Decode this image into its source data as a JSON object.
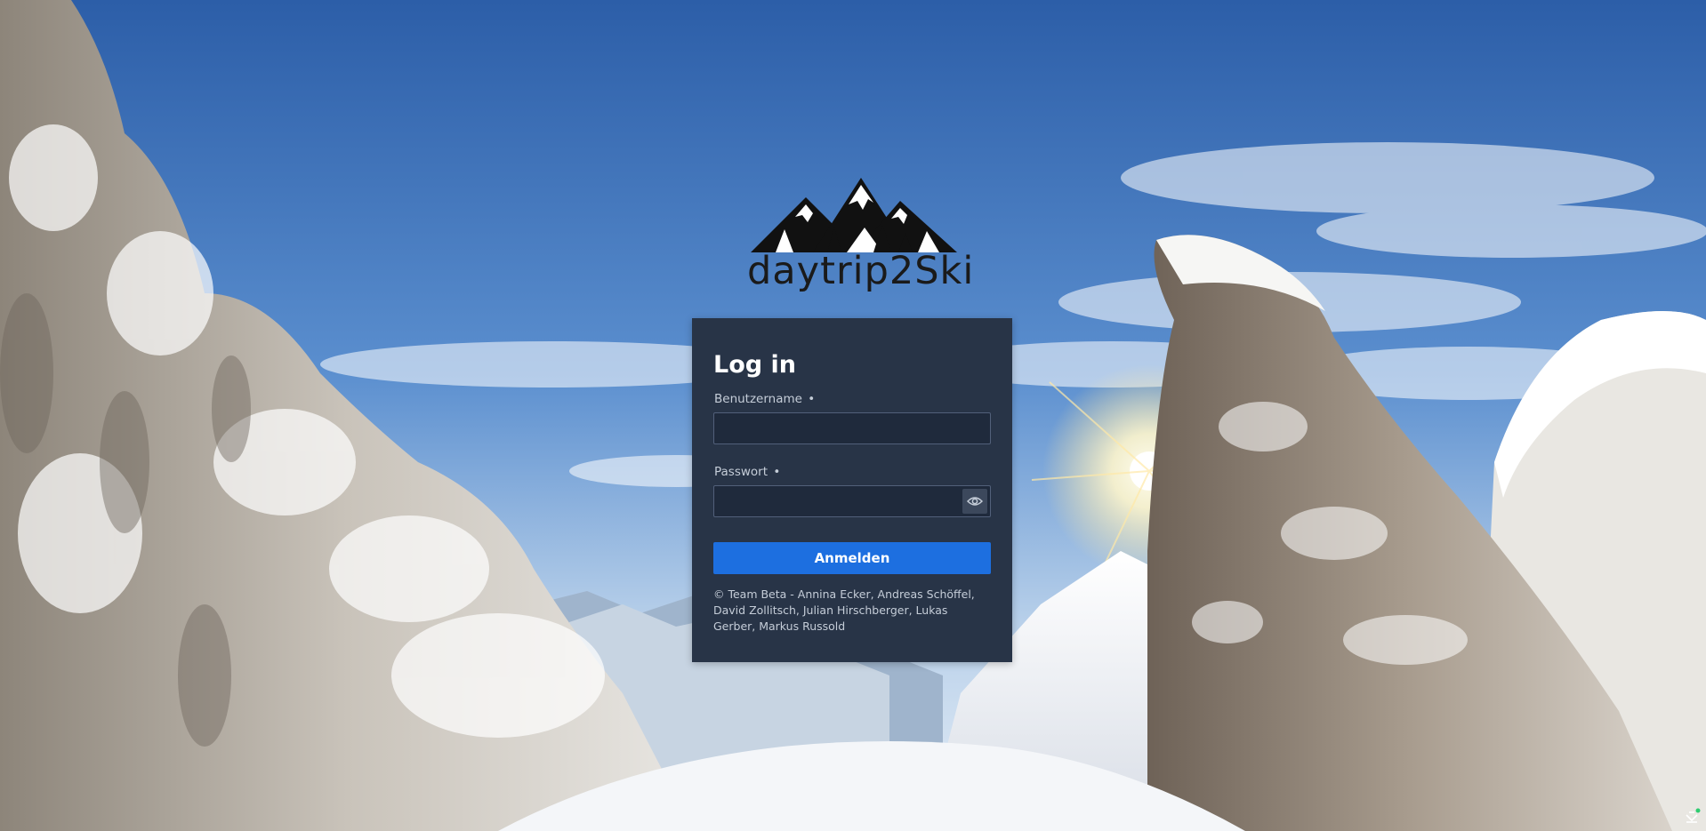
{
  "app": {
    "name": "daytrip2Ski"
  },
  "login": {
    "title": "Log in",
    "username_label": "Benutzername",
    "username_required": "•",
    "username_value": "",
    "password_label": "Passwort",
    "password_required": "•",
    "password_value": "",
    "submit_label": "Anmelden",
    "footer": "© Team Beta - Annina Ecker, Andreas Schöffel, David Zollitsch, Julian Hirschberger, Lukas Gerber, Markus Russold"
  },
  "icons": {
    "logo": "mountains-logo-icon",
    "password_toggle": "eye-icon",
    "corner": "chevron-down-icon"
  },
  "colors": {
    "card_bg": "#283447",
    "input_bg": "#1f2a3c",
    "button_bg": "#1d6fe0",
    "text_primary": "#ffffff",
    "text_secondary": "#c5cdd8"
  }
}
